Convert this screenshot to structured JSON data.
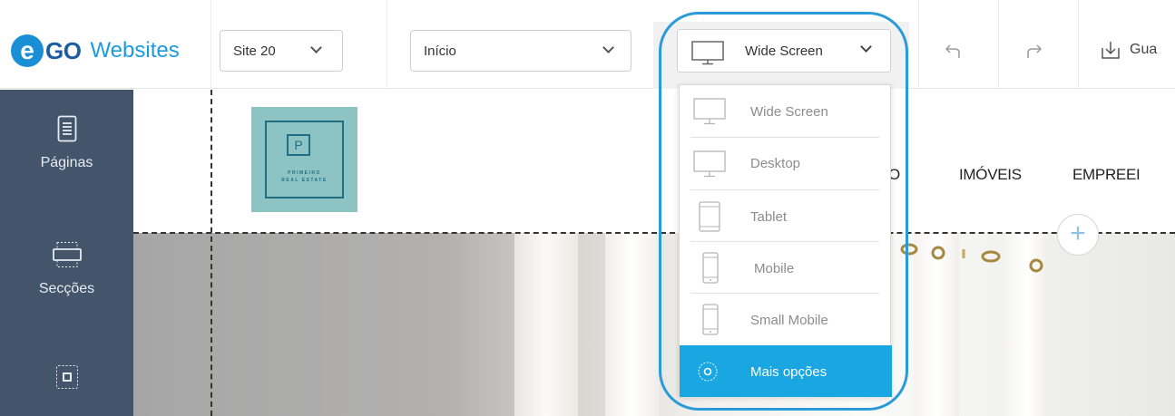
{
  "brand": {
    "e": "e",
    "go": "GO",
    "websites": "Websites"
  },
  "toolbar": {
    "site_select": "Site 20",
    "page_select": "Início",
    "device_select": "Wide Screen",
    "undo_icon": "undo-icon",
    "redo_icon": "redo-icon",
    "save_label": "Gua"
  },
  "sidebar": {
    "items": [
      {
        "label": "Páginas",
        "icon": "pages-icon"
      },
      {
        "label": "Secções",
        "icon": "sections-icon"
      },
      {
        "label": "",
        "icon": "elements-icon"
      }
    ]
  },
  "site": {
    "logo_letter": "P",
    "logo_line1": "PRIMEIRO",
    "logo_line2": "REAL ESTATE",
    "nav": [
      "O",
      "IMÓVEIS",
      "EMPREEI"
    ],
    "add_symbol": "+"
  },
  "device_menu": {
    "items": [
      {
        "label": "Wide Screen",
        "icon": "monitor-icon"
      },
      {
        "label": "Desktop",
        "icon": "monitor-icon"
      },
      {
        "label": "Tablet",
        "icon": "tablet-icon"
      },
      {
        "label": "Mobile",
        "icon": "mobile-icon"
      },
      {
        "label": "Small Mobile",
        "icon": "mobile-icon"
      },
      {
        "label": "Mais opções",
        "icon": "gear-icon"
      }
    ]
  },
  "colors": {
    "accent": "#1aa6e0",
    "sidebar": "#44546a",
    "logo_blue": "#1a8fd6",
    "brand_tile": "#8dc3c3"
  }
}
